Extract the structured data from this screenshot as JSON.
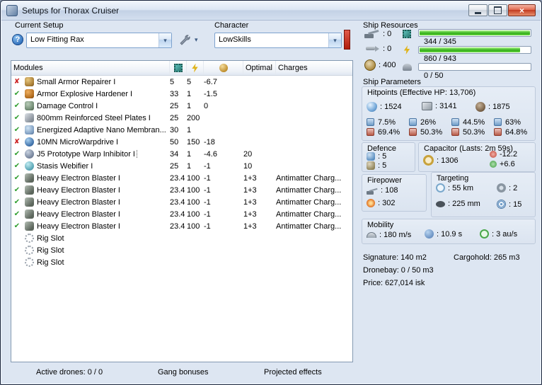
{
  "window": {
    "title": "Setups for Thorax Cruiser"
  },
  "colors": {
    "bar_fill": "#4fc433",
    "status_ok": "#2e9e2e",
    "status_error": "#cc2222",
    "alert_indicator": "#c0392b"
  },
  "header": {
    "current_setup": {
      "label": "Current Setup",
      "value": "Low Fitting Rax"
    },
    "character": {
      "label": "Character",
      "value": "LowSkills"
    }
  },
  "ship_resources": {
    "title": "Ship Resources",
    "hardpoints": [
      {
        "icon": "turret-hardpoint-icon",
        "value": ": 0"
      },
      {
        "icon": "launcher-hardpoint-icon",
        "value": ": 0"
      },
      {
        "icon": "calibration-icon",
        "value": ": 400"
      }
    ],
    "bars": [
      {
        "icon": "cpu-icon",
        "label": "344 / 345",
        "pct": 99.7
      },
      {
        "icon": "powergrid-icon",
        "label": "860 / 943",
        "pct": 91.2
      },
      {
        "icon": "dronebay-icon",
        "label": "0 / 50",
        "pct": 0
      }
    ]
  },
  "ship_parameters": {
    "title": "Ship Parameters",
    "hitpoints": {
      "title": "Hitpoints (Effective HP: 13,706)",
      "values": [
        {
          "icon": "shield-hp-icon",
          "value": ": 1524"
        },
        {
          "icon": "armor-hp-icon",
          "value": ": 3141"
        },
        {
          "icon": "structure-hp-icon",
          "value": ": 1875"
        }
      ],
      "resists": [
        {
          "type": "em",
          "top": "7.5%",
          "bottom": "69.4%"
        },
        {
          "type": "thermal",
          "top": "26%",
          "bottom": "50.3%"
        },
        {
          "type": "kinetic",
          "top": "44.5%",
          "bottom": "50.3%"
        },
        {
          "type": "explosive",
          "top": "63%",
          "bottom": "64.8%"
        }
      ]
    },
    "defence": {
      "title": "Defence",
      "values": [
        {
          "icon": "shield-recharge-icon",
          "value": ": 5"
        },
        {
          "icon": "armor-repair-icon",
          "value": ": 5"
        }
      ]
    },
    "capacitor": {
      "title": "Capacitor (Lasts: 2m 59s)",
      "amount": ": 1306",
      "drain": "-12.2",
      "recharge": "+6.6"
    },
    "firepower": {
      "title": "Firepower",
      "values": [
        {
          "icon": "turret-icon",
          "value": ": 108"
        },
        {
          "icon": "dps-icon",
          "value": ": 302"
        }
      ]
    },
    "targeting": {
      "title": "Targeting",
      "values": [
        {
          "icon": "targeting-range-icon",
          "value": ": 55 km"
        },
        {
          "icon": "max-locked-targets-icon",
          "value": ": 2"
        },
        {
          "icon": "scan-resolution-icon",
          "value": ": 225 mm"
        },
        {
          "icon": "sensor-strength-icon",
          "value": ": 15"
        }
      ]
    },
    "mobility": {
      "title": "Mobility",
      "values": [
        {
          "icon": "max-velocity-icon",
          "value": ": 180 m/s"
        },
        {
          "icon": "align-time-icon",
          "value": ": 10.9 s"
        },
        {
          "icon": "warp-speed-icon",
          "value": ": 3 au/s"
        }
      ]
    },
    "stats": {
      "signature": "Signature: 140 m2",
      "cargohold": "Cargohold: 265 m3",
      "dronebay": "Dronebay: 0 / 50 m3",
      "price": "Price: 627,014 isk"
    }
  },
  "modules_table": {
    "header": {
      "modules": "Modules",
      "optimal": "Optimal",
      "charges": "Charges"
    },
    "rows": [
      {
        "status": "error",
        "icon": "armor-repairer-icon",
        "name": "Small Armor Repairer I",
        "cpu": "5",
        "pg": "5",
        "cap": "-6.7",
        "optimal": "",
        "charges": ""
      },
      {
        "status": "ok",
        "icon": "armor-hardener-icon",
        "name": "Armor Explosive Hardener I",
        "cpu": "33",
        "pg": "1",
        "cap": "-1.5",
        "optimal": "",
        "charges": ""
      },
      {
        "status": "ok",
        "icon": "damage-control-icon",
        "name": "Damage Control I",
        "cpu": "25",
        "pg": "1",
        "cap": "0",
        "optimal": "",
        "charges": ""
      },
      {
        "status": "ok",
        "icon": "armor-plate-icon",
        "name": "800mm Reinforced Steel Plates I",
        "cpu": "25",
        "pg": "200",
        "cap": "",
        "optimal": "",
        "charges": ""
      },
      {
        "status": "ok",
        "icon": "nano-membrane-icon",
        "name": "Energized Adaptive Nano Membran...",
        "cpu": "30",
        "pg": "1",
        "cap": "",
        "optimal": "",
        "charges": ""
      },
      {
        "status": "error",
        "icon": "microwarpdrive-icon",
        "name": "10MN MicroWarpdrive I",
        "cpu": "50",
        "pg": "150",
        "cap": "-18",
        "optimal": "",
        "charges": ""
      },
      {
        "status": "ok",
        "icon": "warp-inhibitor-icon",
        "name": "J5 Prototype Warp Inhibitor I",
        "cpu": "34",
        "pg": "1",
        "cap": "-4.6",
        "optimal": "20",
        "charges": "",
        "selected": true
      },
      {
        "status": "ok",
        "icon": "stasis-webifier-icon",
        "name": "Stasis Webifier I",
        "cpu": "25",
        "pg": "1",
        "cap": "-1",
        "optimal": "10",
        "charges": ""
      },
      {
        "status": "ok",
        "icon": "blaster-icon",
        "name": "Heavy Electron Blaster I",
        "cpu": "23.4",
        "pg": "100",
        "cap": "-1",
        "optimal": "1+3",
        "charges": "Antimatter Charg..."
      },
      {
        "status": "ok",
        "icon": "blaster-icon",
        "name": "Heavy Electron Blaster I",
        "cpu": "23.4",
        "pg": "100",
        "cap": "-1",
        "optimal": "1+3",
        "charges": "Antimatter Charg..."
      },
      {
        "status": "ok",
        "icon": "blaster-icon",
        "name": "Heavy Electron Blaster I",
        "cpu": "23.4",
        "pg": "100",
        "cap": "-1",
        "optimal": "1+3",
        "charges": "Antimatter Charg..."
      },
      {
        "status": "ok",
        "icon": "blaster-icon",
        "name": "Heavy Electron Blaster I",
        "cpu": "23.4",
        "pg": "100",
        "cap": "-1",
        "optimal": "1+3",
        "charges": "Antimatter Charg..."
      },
      {
        "status": "ok",
        "icon": "blaster-icon",
        "name": "Heavy Electron Blaster I",
        "cpu": "23.4",
        "pg": "100",
        "cap": "-1",
        "optimal": "1+3",
        "charges": "Antimatter Charg..."
      },
      {
        "status": "none",
        "icon": "rig-slot-icon",
        "name": "Rig Slot",
        "cpu": "",
        "pg": "",
        "cap": "",
        "optimal": "",
        "charges": ""
      },
      {
        "status": "none",
        "icon": "rig-slot-icon",
        "name": "Rig Slot",
        "cpu": "",
        "pg": "",
        "cap": "",
        "optimal": "",
        "charges": ""
      },
      {
        "status": "none",
        "icon": "rig-slot-icon",
        "name": "Rig Slot",
        "cpu": "",
        "pg": "",
        "cap": "",
        "optimal": "",
        "charges": ""
      }
    ]
  },
  "footer": {
    "active_drones": "Active drones: 0 / 0",
    "gang_bonuses": "Gang bonuses",
    "projected_effects": "Projected effects"
  }
}
